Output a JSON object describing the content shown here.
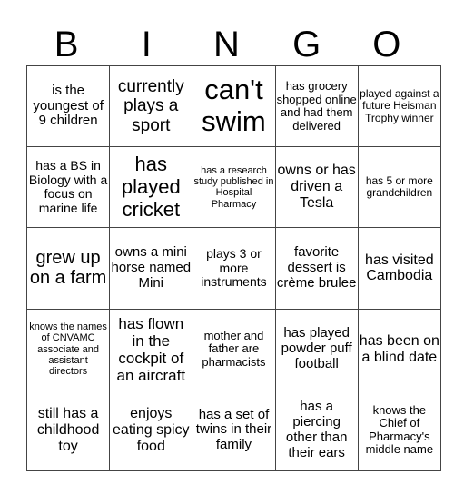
{
  "header": {
    "letters": [
      "B",
      "I",
      "N",
      "G",
      "O"
    ]
  },
  "grid": {
    "rows": [
      [
        "is the youngest of 9 children",
        "currently plays a sport",
        "can't swim",
        "has grocery shopped online and had them delivered",
        "played against a future Heisman Trophy winner"
      ],
      [
        "has a BS in Biology with a focus on marine life",
        "has played cricket",
        "has a research study published in Hospital Pharmacy",
        "owns or has driven a Tesla",
        "has 5 or more grandchildren"
      ],
      [
        "grew up on a farm",
        "owns a mini horse named Mini",
        "plays 3 or more instruments",
        "favorite dessert is crème brulee",
        "has visited Cambodia"
      ],
      [
        "knows the names of CNVAMC associate and assistant directors",
        "has flown in the cockpit of an aircraft",
        "mother and father are pharmacists",
        "has played powder puff football",
        "has been on a blind date"
      ],
      [
        "still has a childhood toy",
        "enjoys eating spicy food",
        "has a set of twins in their family",
        "has a piercing other than their ears",
        "knows the Chief of Pharmacy's middle name"
      ]
    ]
  }
}
